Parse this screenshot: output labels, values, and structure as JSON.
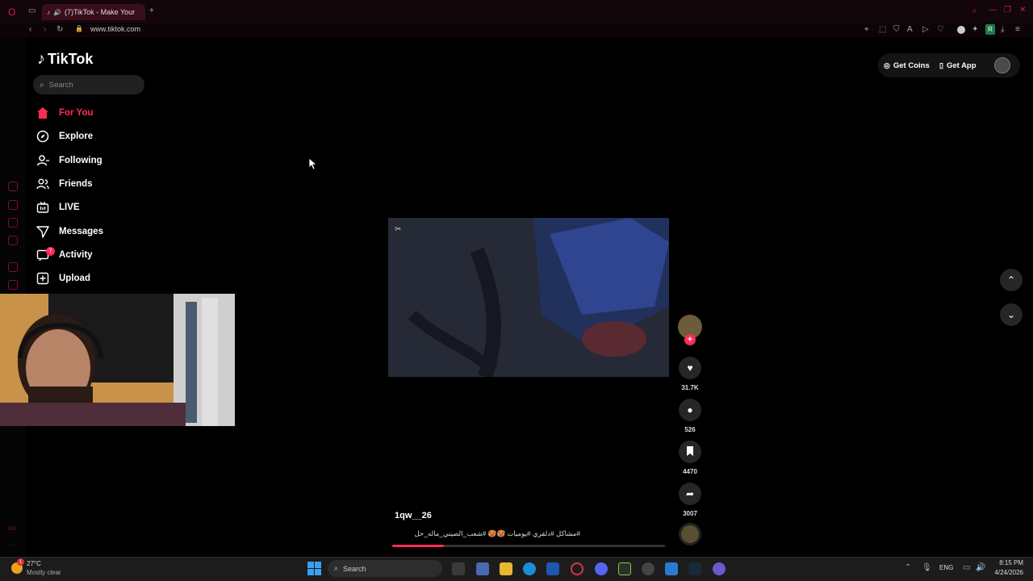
{
  "browser": {
    "tab_title": "(7)TikTok - Make Your",
    "url": "www.tiktok.com"
  },
  "tiktok": {
    "logo": "TikTok",
    "search_placeholder": "Search",
    "nav": {
      "for_you": "For You",
      "explore": "Explore",
      "following": "Following",
      "friends": "Friends",
      "live": "LIVE",
      "messages": "Messages",
      "activity": "Activity",
      "upload": "Upload"
    },
    "activity_badge": "7",
    "get_coins": "Get Coins",
    "get_app": "Get App"
  },
  "video": {
    "username": "1qw__26",
    "caption": "#مشاكل #دلفري #يوميات 🥵🥵 #شعب_الصيني_ماله_حل",
    "progress": 0.19,
    "likes": "31.7K",
    "comments": "526",
    "saves": "4470",
    "shares": "3007"
  },
  "taskbar": {
    "temperature": "27°C",
    "weather": "Mostly clear",
    "weather_badge": "1",
    "search_label": "Search",
    "language": "ENG",
    "time": "8:15 PM",
    "date": "4/24/2026"
  },
  "colors": {
    "accent": "#fe2c55",
    "background": "#000000"
  }
}
